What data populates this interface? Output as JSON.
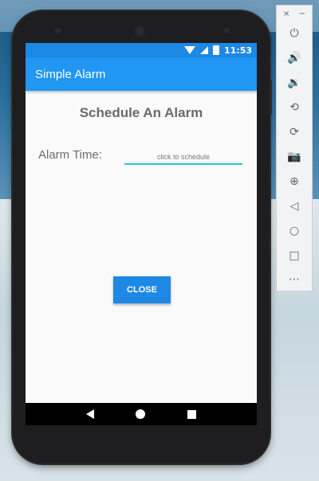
{
  "app": {
    "title": "Simple Alarm"
  },
  "status_bar": {
    "time": "11:53",
    "icons": [
      "wifi-icon",
      "cell-signal-icon",
      "battery-icon"
    ]
  },
  "screen": {
    "heading": "Schedule An Alarm",
    "alarm_time_label": "Alarm Time:",
    "alarm_time_input": {
      "value": "",
      "placeholder": "click to schedule"
    },
    "close_label": "CLOSE"
  },
  "navigation": {
    "icons": [
      "back-icon",
      "home-icon",
      "recent-apps-icon"
    ]
  },
  "emulator_toolbar": {
    "close_glyph": "×",
    "minimize_glyph": "−",
    "items": [
      {
        "name": "power-icon",
        "glyph": "⏻"
      },
      {
        "name": "volume-up-icon",
        "glyph": "🔊"
      },
      {
        "name": "volume-down-icon",
        "glyph": "🔉"
      },
      {
        "name": "rotate-left-icon",
        "glyph": "⟲"
      },
      {
        "name": "rotate-right-icon",
        "glyph": "⟳"
      },
      {
        "name": "camera-icon",
        "glyph": "📷"
      },
      {
        "name": "zoom-icon",
        "glyph": "⊕"
      },
      {
        "name": "back-icon",
        "glyph": "◁"
      },
      {
        "name": "home-icon",
        "glyph": "○"
      },
      {
        "name": "overview-icon",
        "glyph": "□"
      },
      {
        "name": "more-icon",
        "glyph": "⋯"
      }
    ]
  },
  "colors": {
    "primary": "#2196f3",
    "primary_dark": "#1e88e5",
    "accent": "#26c6da"
  }
}
